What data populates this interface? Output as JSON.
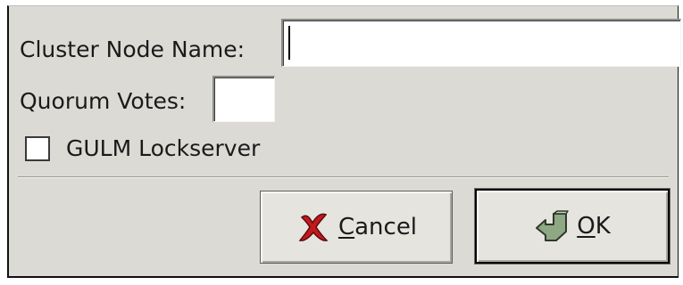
{
  "dialog": {
    "node_name_label": "Cluster Node Name:",
    "node_name_value": "",
    "quorum_label": "Quorum Votes:",
    "quorum_value": "",
    "gulm_label": "GULM Lockserver",
    "gulm_checked": false
  },
  "buttons": {
    "cancel": {
      "mnemonic": "C",
      "rest": "ancel",
      "icon": "cancel-x-icon"
    },
    "ok": {
      "mnemonic": "O",
      "rest": "K",
      "icon": "ok-arrow-icon"
    }
  },
  "colors": {
    "window_bg": "#dcdad5",
    "cancel_icon": "#c2191d",
    "ok_icon": "#8ea784"
  }
}
